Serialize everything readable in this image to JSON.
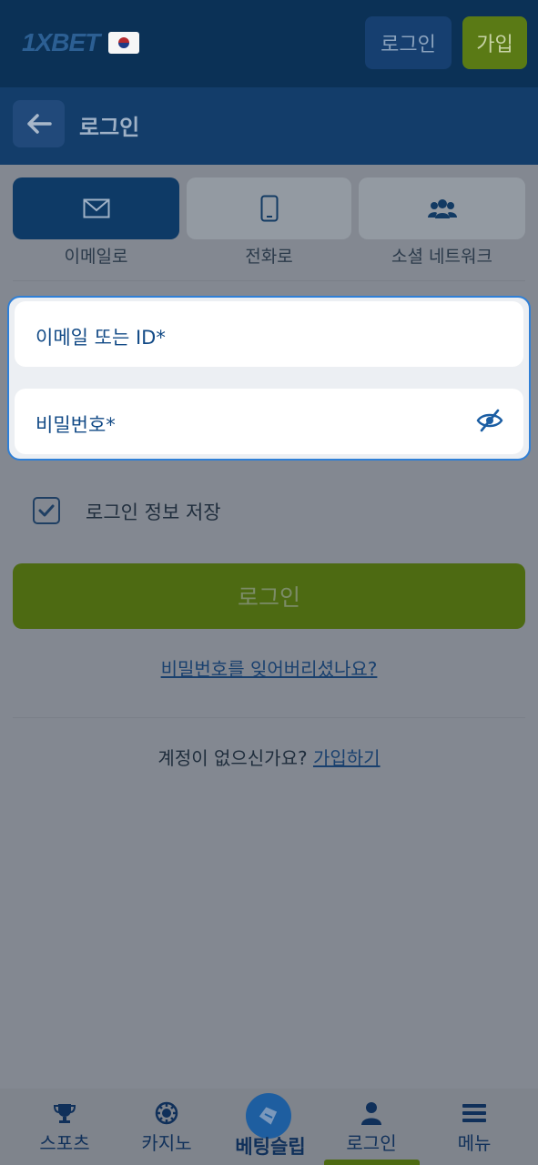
{
  "header": {
    "logo_text": "1XBET",
    "flag_icon": "south-korea-flag-icon",
    "login_label": "로그인",
    "join_label": "가입"
  },
  "subheader": {
    "back_icon": "arrow-left-icon",
    "title": "로그인"
  },
  "login_tabs": [
    {
      "label": "이메일로",
      "icon": "envelope-icon",
      "active": true
    },
    {
      "label": "전화로",
      "icon": "smartphone-icon",
      "active": false
    },
    {
      "label": "소셜 네트워크",
      "icon": "users-icon",
      "active": false
    }
  ],
  "form": {
    "email_placeholder": "이메일 또는 ID*",
    "password_placeholder": "비밀번호*",
    "eye_icon": "eye-slash-icon"
  },
  "remember": {
    "label": "로그인 정보 저장",
    "checked": true
  },
  "actions": {
    "login_label": "로그인",
    "forgot_label": "비밀번호를 잊어버리셨나요?",
    "no_account_text": "계정이 없으신가요?",
    "signup_link": "가입하기"
  },
  "bottom_nav": [
    {
      "label": "스포츠",
      "icon": "trophy-icon"
    },
    {
      "label": "카지노",
      "icon": "casino-chip-icon"
    },
    {
      "label": "베팅슬립",
      "icon": "ticket-icon"
    },
    {
      "label": "로그인",
      "icon": "user-icon",
      "active": true
    },
    {
      "label": "메뉴",
      "icon": "hamburger-menu-icon"
    }
  ],
  "colors": {
    "topbar": "#0b3156",
    "accent_blue": "#2f7fd6",
    "accent_green": "#5a7a15"
  }
}
